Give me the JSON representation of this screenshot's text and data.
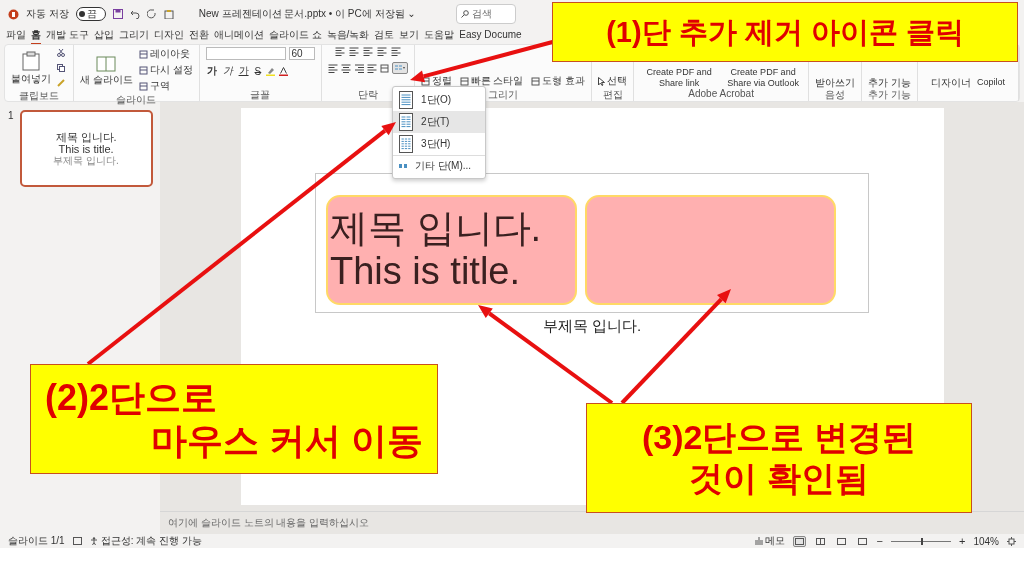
{
  "title_bar": {
    "autosave": {
      "label": "자동 저장",
      "on": false,
      "state_text": "끔"
    },
    "document_title": "New 프레젠테이션 문서.pptx • 이 PC에 저장됨 ⌄",
    "search": {
      "placeholder": "검색"
    }
  },
  "menu_tabs": [
    {
      "label": "파일",
      "selected": false
    },
    {
      "label": "홈",
      "selected": true
    },
    {
      "label": "개발 도구",
      "selected": false
    },
    {
      "label": "삽입",
      "selected": false
    },
    {
      "label": "그리기",
      "selected": false
    },
    {
      "label": "디자인",
      "selected": false
    },
    {
      "label": "전환",
      "selected": false
    },
    {
      "label": "애니메이션",
      "selected": false
    },
    {
      "label": "슬라이드 쇼",
      "selected": false
    },
    {
      "label": "녹음/녹화",
      "selected": false
    },
    {
      "label": "검토",
      "selected": false
    },
    {
      "label": "보기",
      "selected": false
    },
    {
      "label": "도움말",
      "selected": false
    },
    {
      "label": "Easy Docume",
      "selected": false
    }
  ],
  "ribbon": {
    "groups": [
      {
        "kind": "clipboard",
        "name": "클립보드",
        "large": [
          "붙여넣기"
        ]
      },
      {
        "kind": "slides",
        "name": "슬라이드",
        "large": [
          "새 슬라이드"
        ],
        "small": [
          "레이아웃",
          "다시 설정",
          "구역"
        ]
      },
      {
        "kind": "font",
        "name": "글꼴",
        "font_size": "60",
        "format": [
          "가",
          "가",
          "가",
          "S"
        ]
      },
      {
        "kind": "paragraph",
        "name": "단락",
        "columns_pressed": true
      },
      {
        "kind": "drawing",
        "name": "그리기",
        "small": [
          "정렬",
          "빠른 스타일",
          "도형 효과"
        ]
      },
      {
        "kind": "editing",
        "name": "편집",
        "small": [
          "선택"
        ]
      },
      {
        "kind": "text",
        "name": "Adobe Acrobat",
        "text": [
          "Create PDF and Share link",
          "Create PDF and Share via Outlook"
        ]
      },
      {
        "kind": "text",
        "name": "음성",
        "text": [
          "받아쓰기"
        ]
      },
      {
        "kind": "text",
        "name": "추가 기능",
        "text": [
          "추가 기능"
        ]
      },
      {
        "kind": "text",
        "text": [
          "디자이너",
          "Copilot"
        ]
      }
    ]
  },
  "thumbnails": [
    {
      "number": "1",
      "selected": true,
      "title_lines": [
        "제목 입니다.",
        "This is title."
      ],
      "subtitle": "부제목 입니다."
    }
  ],
  "slide": {
    "columns": [
      {
        "kind": "text",
        "lines": [
          "제목 입니다.",
          "This is title."
        ]
      },
      {
        "kind": "empty"
      }
    ],
    "subtitle": "부제목 입니다."
  },
  "column_menu": {
    "items": [
      {
        "kind": "one",
        "label": "1단(O)",
        "selected": false
      },
      {
        "kind": "two",
        "label": "2단(T)",
        "selected": true
      },
      {
        "kind": "three",
        "label": "3단(H)",
        "selected": false
      },
      {
        "kind": "more",
        "label": "기타 단(M)...",
        "selected": false
      }
    ]
  },
  "notes": {
    "placeholder": "여기에 슬라이드 노트의 내용을 입력하십시오"
  },
  "status_bar": {
    "slide_counter": "슬라이드 1/1",
    "accessibility": "접근성: 계속 진행 가능",
    "notes_button": "메모",
    "views": [
      {
        "selected": true
      },
      {
        "selected": false
      },
      {
        "selected": false
      },
      {
        "selected": false
      }
    ],
    "zoom": {
      "out_sign": "−",
      "in_sign": "+",
      "level": 0.5,
      "reading": "104%"
    }
  },
  "callouts": [
    {
      "lines": [
        "(1)단 추가 제거 아이콘 클릭"
      ]
    },
    {
      "lines": [
        "(2)2단으로",
        "마우스 커서 이동"
      ]
    },
    {
      "lines": [
        "(3)2단으로 변경된",
        "것이 확인됨"
      ]
    }
  ]
}
